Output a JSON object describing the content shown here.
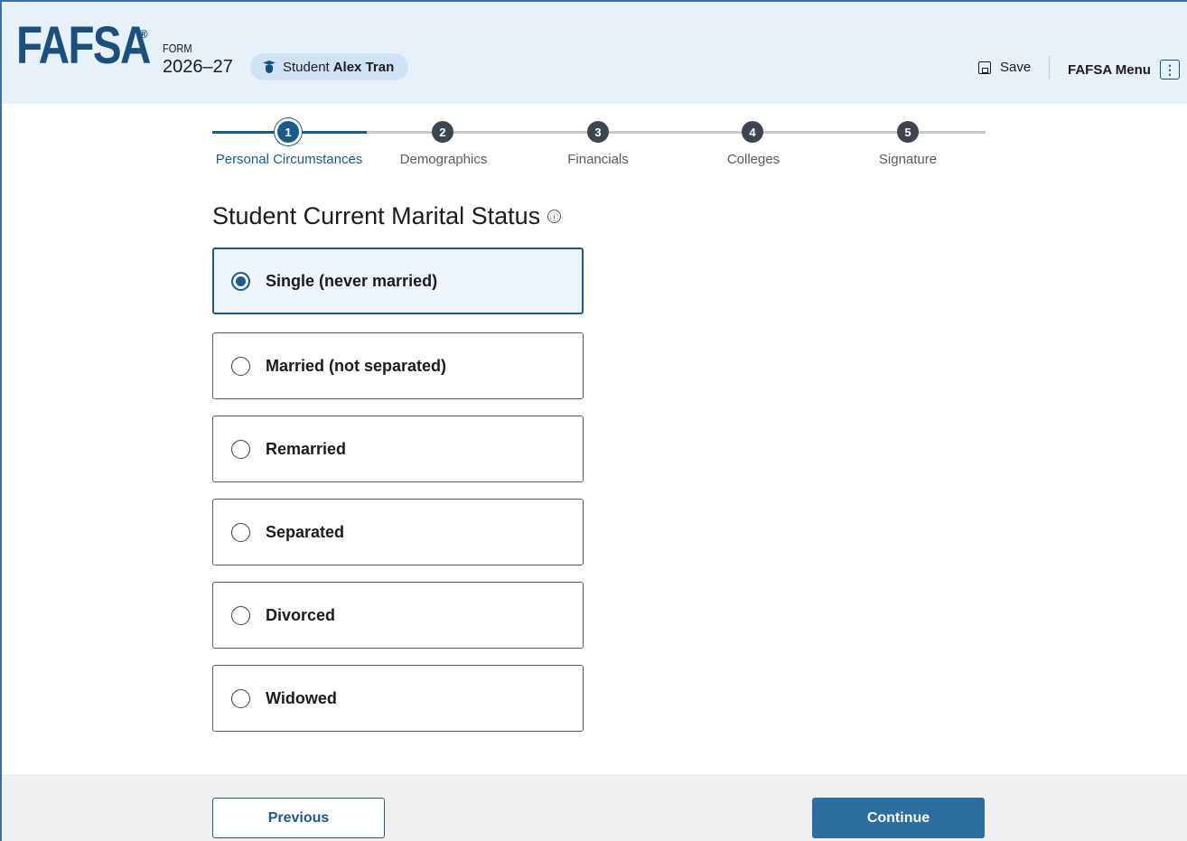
{
  "header": {
    "logo": "FAFSA",
    "registered": "®",
    "form_label": "FORM",
    "form_year": "2026–27",
    "role_label": "Student",
    "student_name": "Alex Tran",
    "save_label": "Save",
    "menu_label": "FAFSA Menu",
    "menu_icon": "⋮"
  },
  "stepper": {
    "steps": [
      {
        "number": "1",
        "label": "Personal Circumstances",
        "state": "active"
      },
      {
        "number": "2",
        "label": "Demographics",
        "state": "upcoming"
      },
      {
        "number": "3",
        "label": "Financials",
        "state": "upcoming"
      },
      {
        "number": "4",
        "label": "Colleges",
        "state": "upcoming"
      },
      {
        "number": "5",
        "label": "Signature",
        "state": "upcoming"
      }
    ]
  },
  "question": {
    "title": "Student Current Marital Status",
    "info_icon": "ⓘ",
    "options": [
      {
        "label": "Single (never married)",
        "selected": true
      },
      {
        "label": "Married (not separated)",
        "selected": false
      },
      {
        "label": "Remarried",
        "selected": false
      },
      {
        "label": "Separated",
        "selected": false
      },
      {
        "label": "Divorced",
        "selected": false
      },
      {
        "label": "Widowed",
        "selected": false
      }
    ]
  },
  "footer": {
    "previous_label": "Previous",
    "continue_label": "Continue"
  },
  "colors": {
    "primary": "#1c5a8a",
    "header_bg": "#e6f1fa",
    "button_bg": "#2b6fa0"
  }
}
